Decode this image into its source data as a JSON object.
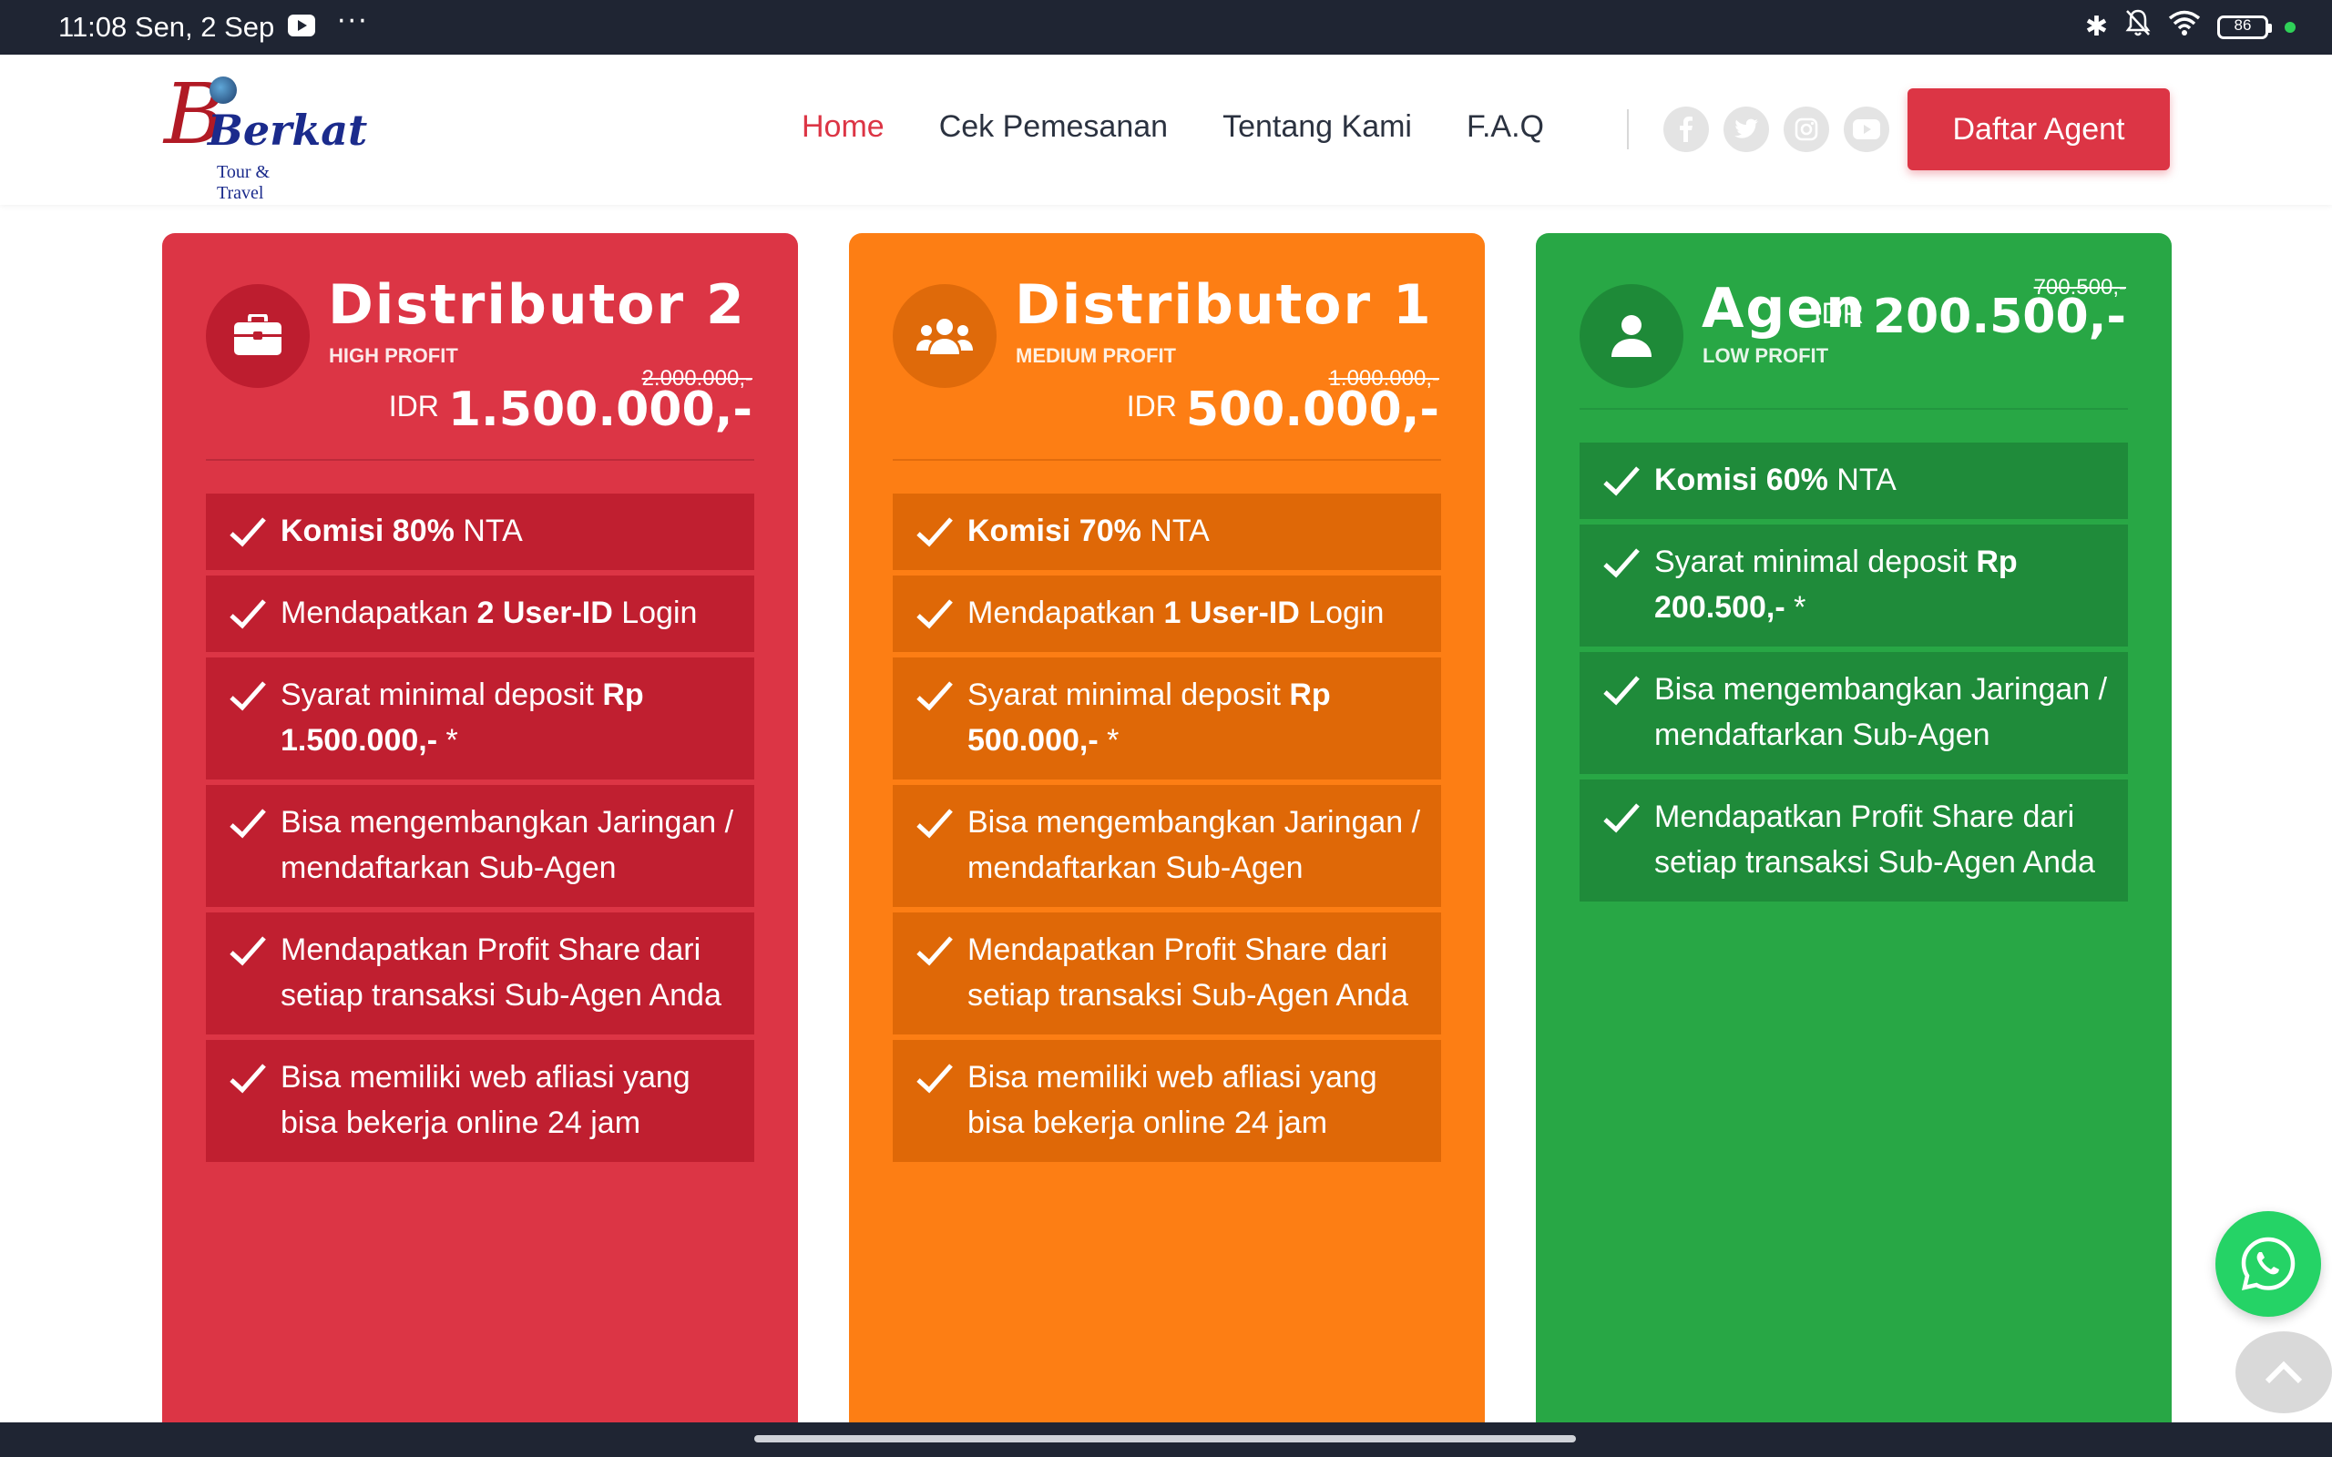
{
  "status_bar": {
    "time": "11:08 Sen, 2 Sep",
    "dots": "···",
    "battery": "86"
  },
  "header": {
    "logo": {
      "text": "Berkat",
      "sub": "Tour & Travel"
    },
    "nav": [
      "Home",
      "Cek Pemesanan",
      "Tentang Kami",
      "F.A.Q"
    ],
    "social": [
      "f",
      "t",
      "◎",
      "▶"
    ],
    "cta": "Daftar Agent"
  },
  "cards": [
    {
      "title": "Distributor 2",
      "subtitle": "HIGH PROFIT",
      "old_price": "2.000.000,-",
      "currency": "IDR",
      "price": "1.500.000,-",
      "features": [
        {
          "pre": "",
          "bold": "Komisi 80%",
          "post": " NTA"
        },
        {
          "pre": "Mendapatkan ",
          "bold": "2 User-ID",
          "post": " Login"
        },
        {
          "pre": "Syarat minimal deposit ",
          "bold": "Rp 1.500.000,-",
          "post": " *"
        },
        {
          "pre": "Bisa mengembangkan Jaringan / mendaftarkan Sub-Agen",
          "bold": "",
          "post": ""
        },
        {
          "pre": "Mendapatkan Profit Share dari setiap transaksi Sub-Agen Anda",
          "bold": "",
          "post": ""
        },
        {
          "pre": "Bisa memiliki web afliasi yang bisa bekerja online 24 jam",
          "bold": "",
          "post": ""
        }
      ]
    },
    {
      "title": "Distributor 1",
      "subtitle": "MEDIUM PROFIT",
      "old_price": "1.000.000,-",
      "currency": "IDR",
      "price": "500.000,-",
      "features": [
        {
          "pre": "",
          "bold": "Komisi 70%",
          "post": " NTA"
        },
        {
          "pre": "Mendapatkan ",
          "bold": "1 User-ID",
          "post": " Login"
        },
        {
          "pre": "Syarat minimal deposit ",
          "bold": "Rp 500.000,-",
          "post": " *"
        },
        {
          "pre": "Bisa mengembangkan Jaringan / mendaftarkan Sub-Agen",
          "bold": "",
          "post": ""
        },
        {
          "pre": "Mendapatkan Profit Share dari setiap transaksi Sub-Agen Anda",
          "bold": "",
          "post": ""
        },
        {
          "pre": "Bisa memiliki web afliasi yang bisa bekerja online 24 jam",
          "bold": "",
          "post": ""
        }
      ]
    },
    {
      "title": "Agen",
      "subtitle": "LOW PROFIT",
      "old_price": "700.500,-",
      "currency": "IDR",
      "price": "200.500,-",
      "features": [
        {
          "pre": "",
          "bold": "Komisi 60%",
          "post": " NTA"
        },
        {
          "pre": "Syarat minimal deposit ",
          "bold": "Rp 200.500,-",
          "post": " *"
        },
        {
          "pre": "Bisa mengembangkan Jaringan / mendaftarkan Sub-Agen",
          "bold": "",
          "post": ""
        },
        {
          "pre": "Mendapatkan Profit Share dari setiap transaksi Sub-Agen Anda",
          "bold": "",
          "post": ""
        }
      ]
    }
  ],
  "icons": {
    "card_0": "briefcase-icon",
    "card_1": "users-icon",
    "card_2": "user-icon",
    "feature": "check-icon",
    "whatsapp": "whatsapp-icon",
    "scroll_top": "chevron-up-icon"
  },
  "colors": {
    "red": "#dc3545",
    "orange": "#fd7e14",
    "green": "#28a745",
    "nav_active": "#dc3545",
    "whatsapp": "#25d366"
  }
}
